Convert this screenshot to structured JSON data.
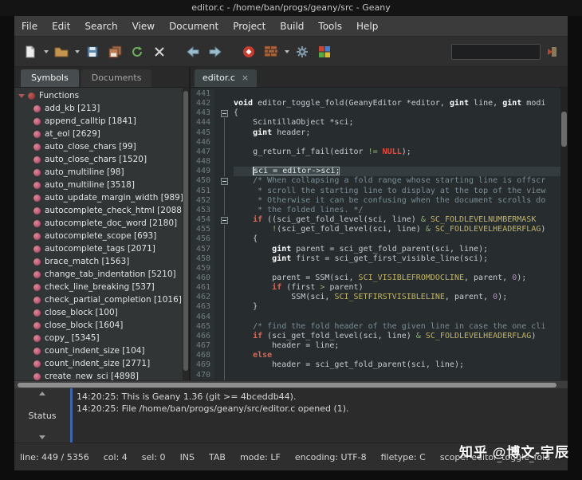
{
  "window": {
    "title": "editor.c - /home/ban/progs/geany/src - Geany"
  },
  "menu": {
    "items": [
      "File",
      "Edit",
      "Search",
      "View",
      "Document",
      "Project",
      "Build",
      "Tools",
      "Help"
    ]
  },
  "toolbar": {
    "search_value": ""
  },
  "sidebar": {
    "tabs": [
      "Symbols",
      "Documents"
    ],
    "root": "Functions",
    "functions": [
      "add_kb [213]",
      "append_calltip [1841]",
      "at_eol [2629]",
      "auto_close_chars [99]",
      "auto_close_chars [1520]",
      "auto_multiline [98]",
      "auto_multiline [3518]",
      "auto_update_margin_width [989]",
      "autocomplete_check_html [2088]",
      "autocomplete_doc_word [2180]",
      "autocomplete_scope [693]",
      "autocomplete_tags [2071]",
      "brace_match [1563]",
      "change_tab_indentation [5210]",
      "check_line_breaking [537]",
      "check_partial_completion [1016]",
      "close_block [100]",
      "close_block [1604]",
      "copy_ [5345]",
      "count_indent_size [104]",
      "count_indent_size [2771]",
      "create_new_sci [4898]"
    ]
  },
  "editor": {
    "tab_label": "editor.c",
    "tab_close": "×",
    "lines": [
      {
        "n": 441,
        "f": "n",
        "s": []
      },
      {
        "n": 442,
        "f": "n",
        "s": [
          [
            "t",
            "void"
          ],
          [
            "p",
            " editor_toggle_fold(GeanyEditor *editor, "
          ],
          [
            "t",
            "gint"
          ],
          [
            "p",
            " line, "
          ],
          [
            "t",
            "gint"
          ],
          [
            "p",
            " modi"
          ]
        ]
      },
      {
        "n": 443,
        "f": "b",
        "s": [
          [
            "p",
            "{"
          ]
        ]
      },
      {
        "n": 444,
        "f": "l",
        "s": [
          [
            "p",
            "    ScintillaObject *sci;"
          ]
        ]
      },
      {
        "n": 445,
        "f": "l",
        "s": [
          [
            "p",
            "    "
          ],
          [
            "t",
            "gint"
          ],
          [
            "p",
            " header;"
          ]
        ]
      },
      {
        "n": 446,
        "f": "l",
        "s": []
      },
      {
        "n": 447,
        "f": "l",
        "s": [
          [
            "p",
            "    g_return_if_fail(editor "
          ],
          [
            "o",
            "!="
          ],
          [
            "p",
            " "
          ],
          [
            "x",
            "NULL"
          ],
          [
            "p",
            ");"
          ]
        ]
      },
      {
        "n": 448,
        "f": "l",
        "s": []
      },
      {
        "n": 449,
        "f": "l",
        "cur": true,
        "s": [
          [
            "p",
            "    "
          ],
          [
            "h",
            "sci = editor->sci;"
          ]
        ]
      },
      {
        "n": 450,
        "f": "b",
        "s": [
          [
            "m",
            "    /* When collapsing a fold range whose starting line is offscr"
          ]
        ]
      },
      {
        "n": 451,
        "f": "l",
        "s": [
          [
            "m",
            "     * scroll the starting line to display at the top of the view"
          ]
        ]
      },
      {
        "n": 452,
        "f": "l",
        "s": [
          [
            "m",
            "     * Otherwise it can be confusing when the document scrolls do"
          ]
        ]
      },
      {
        "n": 453,
        "f": "l",
        "s": [
          [
            "m",
            "     * the folded lines. */"
          ]
        ]
      },
      {
        "n": 454,
        "f": "b",
        "s": [
          [
            "p",
            "    "
          ],
          [
            "k",
            "if"
          ],
          [
            "p",
            " ((sci_get_fold_level(sci, line) "
          ],
          [
            "o",
            "&"
          ],
          [
            "p",
            " "
          ],
          [
            "c",
            "SC_FOLDLEVELNUMBERMASK"
          ]
        ]
      },
      {
        "n": 455,
        "f": "l",
        "s": [
          [
            "p",
            "        "
          ],
          [
            "o",
            "!"
          ],
          [
            "p",
            "(sci_get_fold_level(sci, line) "
          ],
          [
            "o",
            "&"
          ],
          [
            "p",
            " "
          ],
          [
            "c",
            "SC_FOLDLEVELHEADERFLAG"
          ],
          [
            "p",
            ")"
          ]
        ]
      },
      {
        "n": 456,
        "f": "l",
        "s": [
          [
            "p",
            "    {"
          ]
        ]
      },
      {
        "n": 457,
        "f": "l",
        "s": [
          [
            "p",
            "        "
          ],
          [
            "t",
            "gint"
          ],
          [
            "p",
            " parent = sci_get_fold_parent(sci, line);"
          ]
        ]
      },
      {
        "n": 458,
        "f": "l",
        "s": [
          [
            "p",
            "        "
          ],
          [
            "t",
            "gint"
          ],
          [
            "p",
            " first = sci_get_first_visible_line(sci);"
          ]
        ]
      },
      {
        "n": 459,
        "f": "l",
        "s": []
      },
      {
        "n": 460,
        "f": "l",
        "s": [
          [
            "p",
            "        parent = SSM(sci, "
          ],
          [
            "c",
            "SCI_VISIBLEFROMDOCLINE"
          ],
          [
            "p",
            ", parent, "
          ],
          [
            "d",
            "0"
          ],
          [
            "p",
            ");"
          ]
        ]
      },
      {
        "n": 461,
        "f": "l",
        "s": [
          [
            "p",
            "        "
          ],
          [
            "k",
            "if"
          ],
          [
            "p",
            " (first "
          ],
          [
            "o",
            ">"
          ],
          [
            "p",
            " parent)"
          ]
        ]
      },
      {
        "n": 462,
        "f": "l",
        "s": [
          [
            "p",
            "            SSM(sci, "
          ],
          [
            "c",
            "SCI_SETFIRSTVISIBLELINE"
          ],
          [
            "p",
            ", parent, "
          ],
          [
            "d",
            "0"
          ],
          [
            "p",
            ");"
          ]
        ]
      },
      {
        "n": 463,
        "f": "l",
        "s": [
          [
            "p",
            "    }"
          ]
        ]
      },
      {
        "n": 464,
        "f": "l",
        "s": []
      },
      {
        "n": 465,
        "f": "l",
        "s": [
          [
            "m",
            "    /* find the fold header of the given line in case the one cli"
          ]
        ]
      },
      {
        "n": 466,
        "f": "l",
        "s": [
          [
            "p",
            "    "
          ],
          [
            "k",
            "if"
          ],
          [
            "p",
            " (sci_get_fold_level(sci, line) "
          ],
          [
            "o",
            "&"
          ],
          [
            "p",
            " "
          ],
          [
            "c",
            "SC_FOLDLEVELHEADERFLAG"
          ],
          [
            "p",
            ")"
          ]
        ]
      },
      {
        "n": 467,
        "f": "l",
        "s": [
          [
            "p",
            "        header = line;"
          ]
        ]
      },
      {
        "n": 468,
        "f": "l",
        "s": [
          [
            "p",
            "    "
          ],
          [
            "k",
            "else"
          ]
        ]
      },
      {
        "n": 469,
        "f": "l",
        "s": [
          [
            "p",
            "        header = sci_get_fold_parent(sci, line);"
          ]
        ]
      },
      {
        "n": 470,
        "f": "l",
        "s": []
      }
    ]
  },
  "messages_panel": {
    "tab": "Status",
    "lines": [
      "14:20:25: This is Geany 1.36 (git >= 4bceddb44).",
      "14:20:25: File /home/ban/progs/geany/src/editor.c opened (1)."
    ]
  },
  "statusbar": {
    "fields": [
      "line: 449 / 5356",
      "col: 4",
      "sel: 0",
      "INS",
      "TAB",
      "mode: LF",
      "encoding: UTF-8",
      "filetype: C",
      "scope: editor_toggle_fold"
    ]
  },
  "watermark": "知乎 @博文-宇辰"
}
